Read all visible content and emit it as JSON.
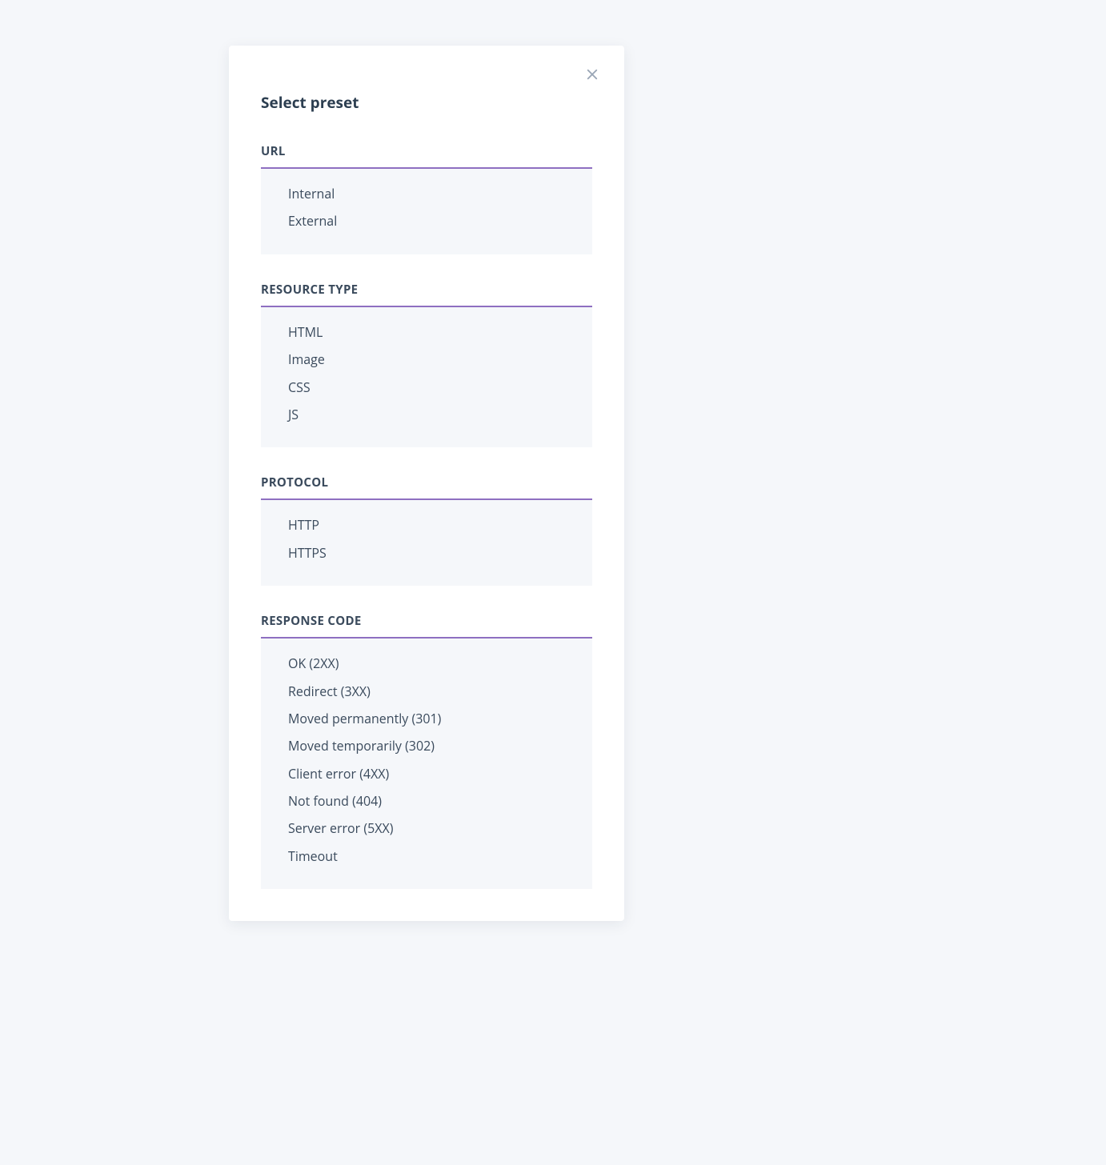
{
  "dialog": {
    "title": "Select preset",
    "sections": [
      {
        "header": "URL",
        "items": [
          "Internal",
          "External"
        ]
      },
      {
        "header": "RESOURCE TYPE",
        "items": [
          "HTML",
          "Image",
          "CSS",
          "JS"
        ]
      },
      {
        "header": "PROTOCOL",
        "items": [
          "HTTP",
          "HTTPS"
        ]
      },
      {
        "header": "RESPONSE CODE",
        "items": [
          "OK (2XX)",
          "Redirect (3XX)",
          "Moved permanently (301)",
          "Moved temporarily (302)",
          "Client error (4XX)",
          "Not found (404)",
          "Server error (5XX)",
          "Timeout"
        ]
      }
    ]
  }
}
